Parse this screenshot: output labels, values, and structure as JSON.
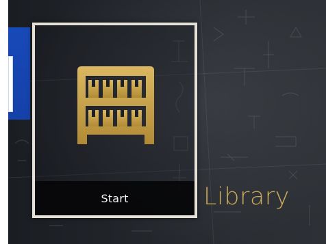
{
  "tiles": {
    "selected": {
      "action_label": "Start",
      "icon": "library-shelf-icon",
      "title": "Library",
      "border_color": "#e5e1d6",
      "icon_color": "#c9a24a",
      "title_color": "#c9a85a"
    },
    "previous": {
      "accent_color": "#1749b8"
    }
  },
  "background": {
    "base_color": "#22262b"
  }
}
